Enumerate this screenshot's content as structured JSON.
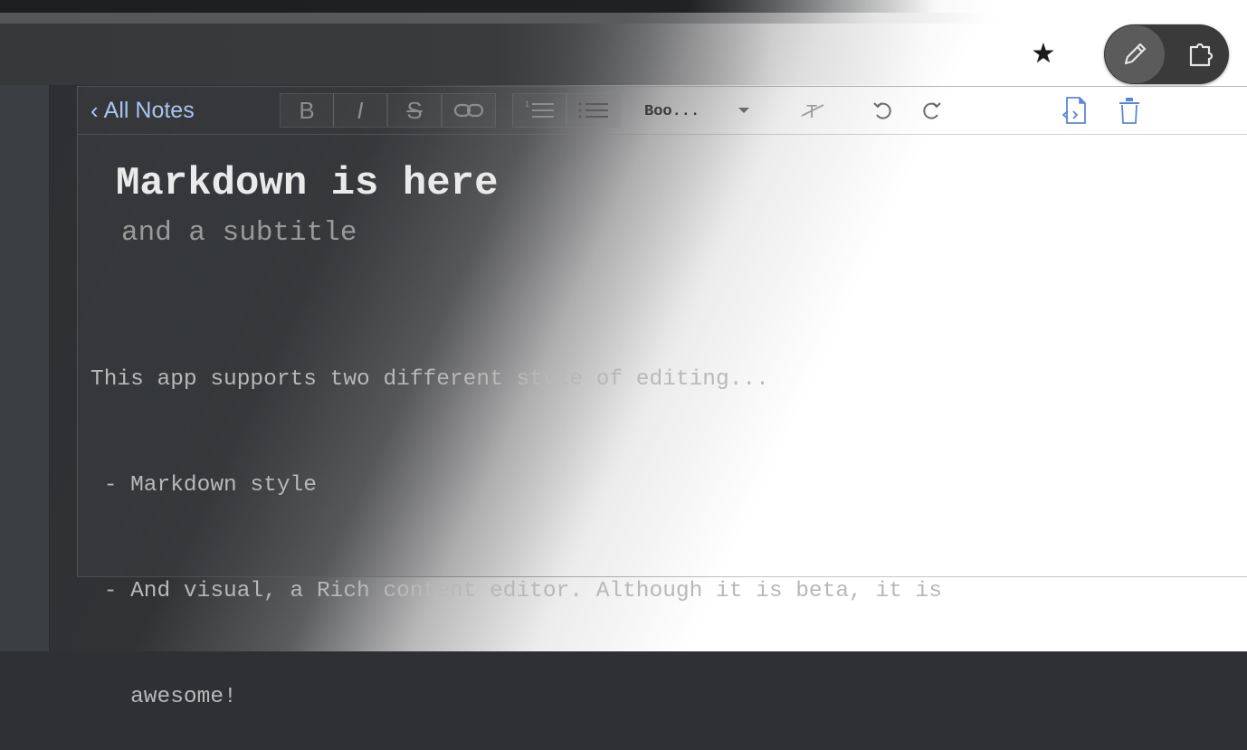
{
  "header": {
    "star_icon": "star-icon",
    "mode_toggle": {
      "active": "edit",
      "left_icon": "pencil-icon",
      "right_icon": "extension-icon"
    }
  },
  "toolbar": {
    "back_label": "All Notes",
    "buttons": [
      {
        "name": "bold-button",
        "label": "B"
      },
      {
        "name": "italic-button",
        "label": "I"
      },
      {
        "name": "strikethrough-button",
        "label": "S"
      },
      {
        "name": "link-button",
        "label": "link-icon"
      },
      {
        "name": "ordered-list-button",
        "label": "ordered-list-icon"
      },
      {
        "name": "bullet-list-button",
        "label": "bullet-list-icon"
      }
    ],
    "style_select_value": "Boo...",
    "clear_format_icon": "clear-format-icon",
    "undo_icon": "undo-icon",
    "redo_icon": "redo-icon",
    "code_view_icon": "code-file-icon",
    "delete_icon": "trash-icon"
  },
  "note": {
    "title": "Markdown is here",
    "subtitle": "and a subtitle",
    "lines": [
      "This app supports two different style of editing...",
      " - Markdown style",
      " - And visual, a Rich content editor. Although it is beta, it is",
      "   awesome!"
    ]
  },
  "colors": {
    "link": "#a9c4f2",
    "title": "#eaeaea",
    "subtitle": "#9a9a9a",
    "body": "#b8b8b8"
  }
}
